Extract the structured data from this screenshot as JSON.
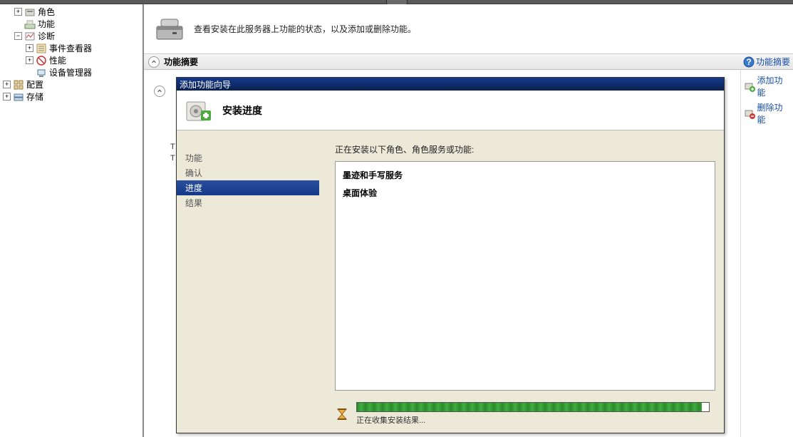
{
  "tree": {
    "roles": "角色",
    "features": "功能",
    "diagnostics": "诊断",
    "event_viewer": "事件查看器",
    "performance": "性能",
    "device_manager": "设备管理器",
    "config": "配置",
    "storage": "存储"
  },
  "banner": {
    "text": "查看安装在此服务器上功能的状态，以及添加或删除功能。"
  },
  "summary": {
    "title": "功能摘要",
    "help": "功能摘要"
  },
  "actions": {
    "add": "添加功能",
    "remove": "删除功能"
  },
  "wizard": {
    "title": "添加功能向导",
    "header": "安装进度",
    "nav": {
      "features": "功能",
      "confirm": "确认",
      "progress": "进度",
      "results": "结果"
    },
    "installing_label": "正在安装以下角色、角色服务或功能:",
    "features_list": [
      "墨迹和手写服务",
      "桌面体验"
    ],
    "progress_text": "正在收集安装结果..."
  }
}
